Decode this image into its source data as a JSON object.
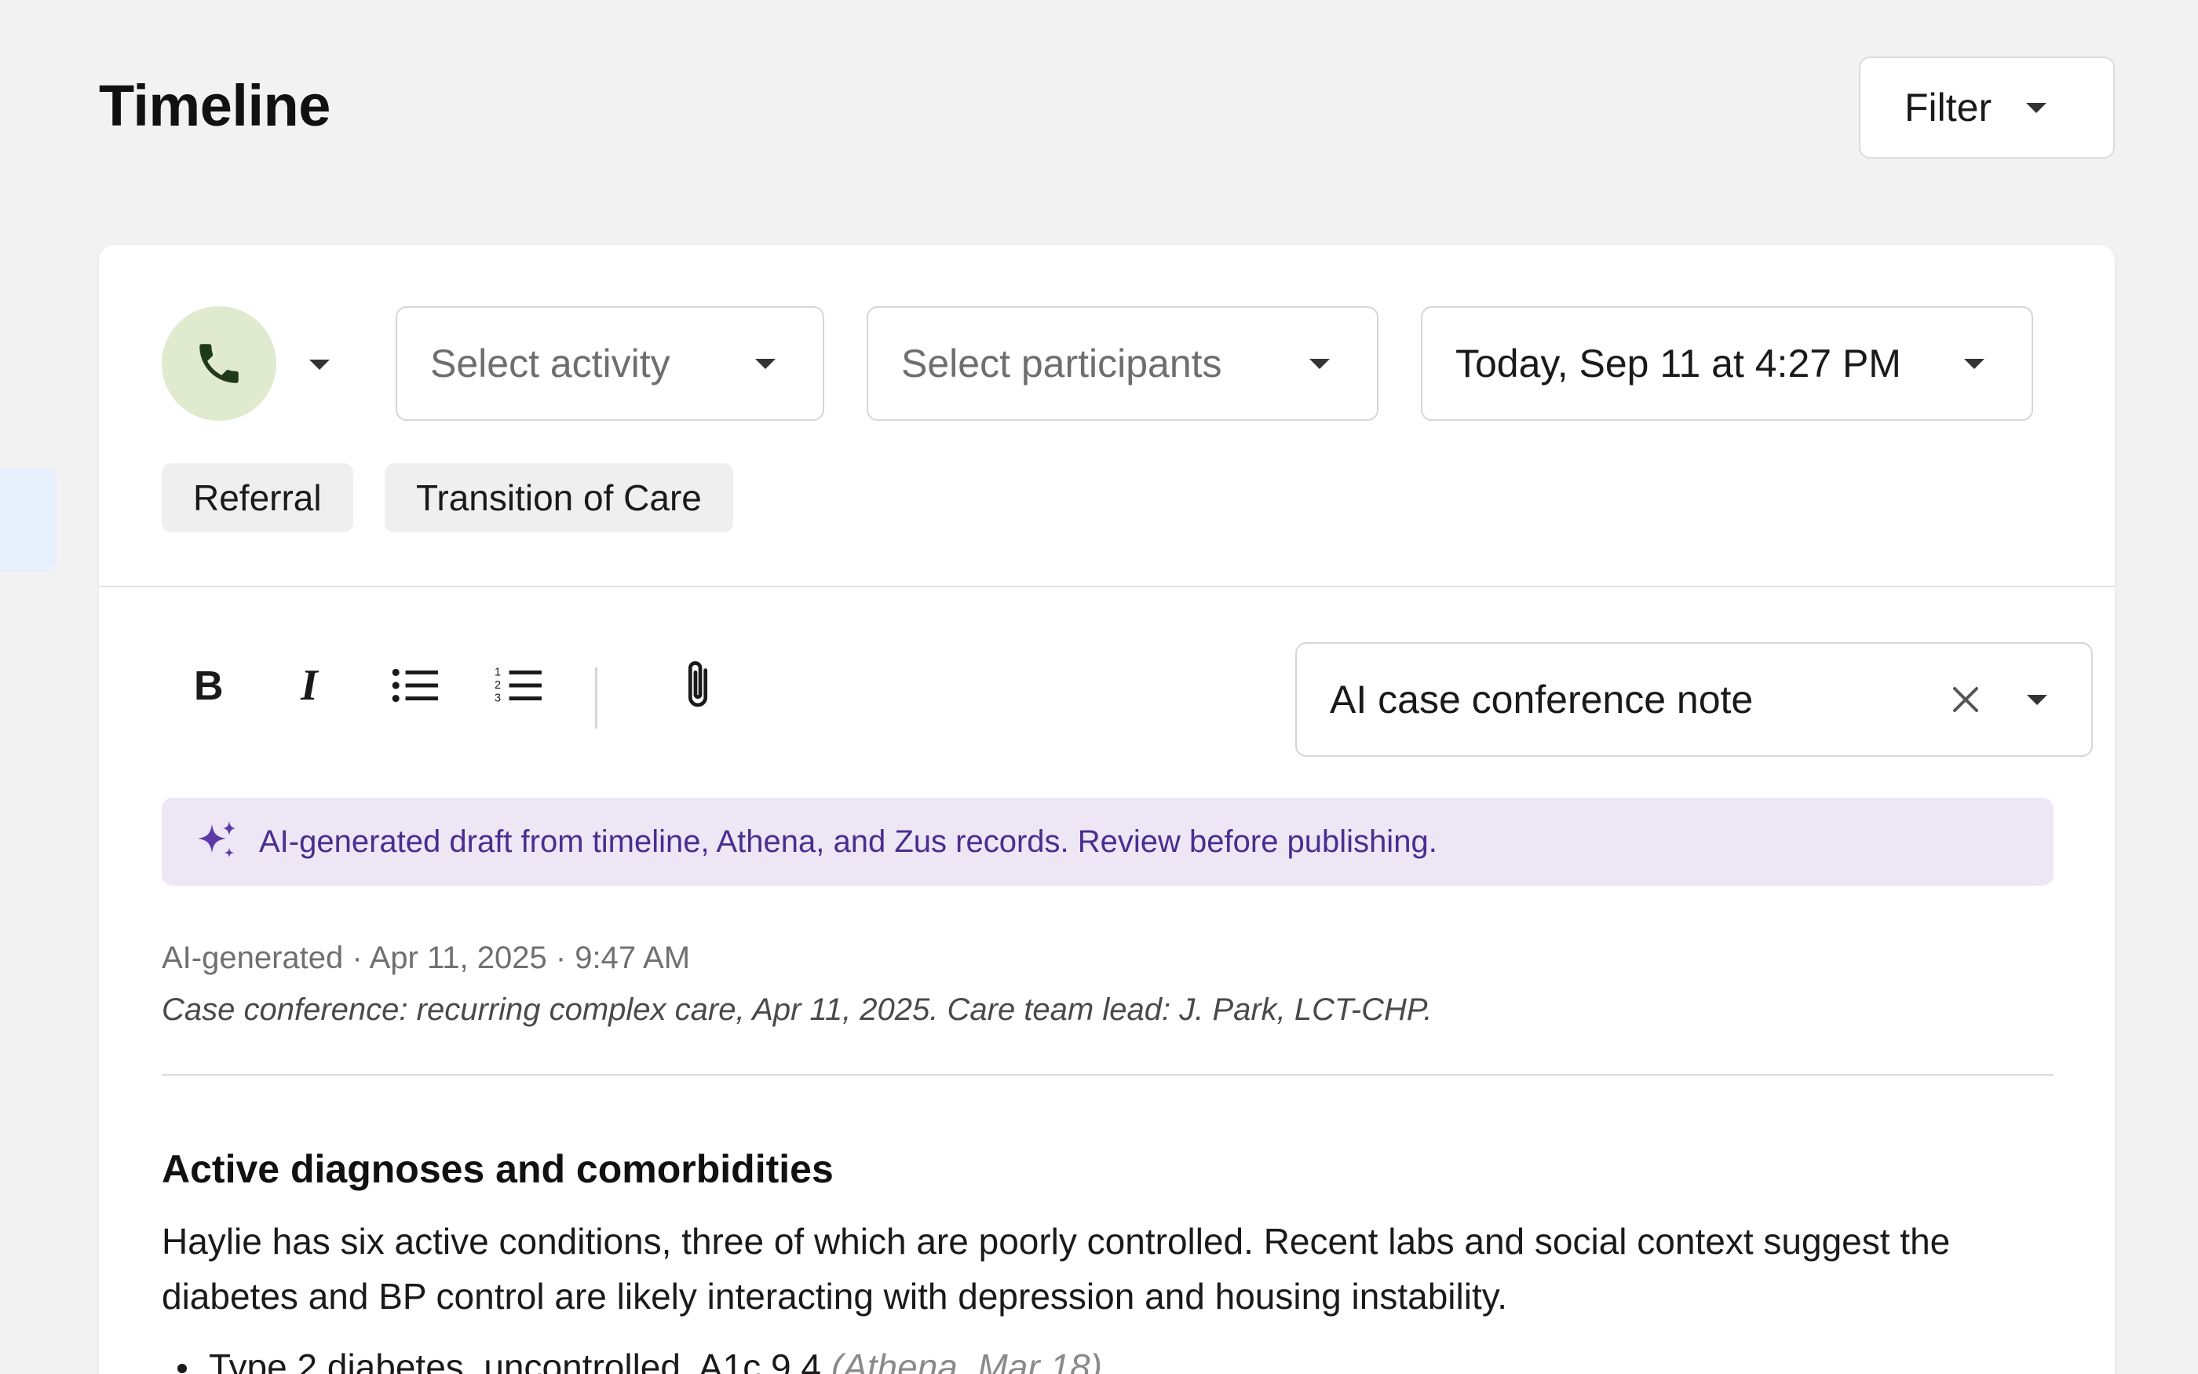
{
  "header": {
    "title": "Timeline",
    "filter_label": "Filter"
  },
  "composer": {
    "activity_type_icon": "phone-icon",
    "activity_placeholder": "Select activity",
    "participants_placeholder": "Select participants",
    "datetime": "Today, Sep 11 at 4:27 PM",
    "tags": [
      "Referral",
      "Transition of Care"
    ]
  },
  "toolbar": {
    "bold_icon": "bold-icon",
    "italic_icon": "italic-icon",
    "bullet_list_icon": "bulleted-list-icon",
    "numbered_list_icon": "numbered-list-icon",
    "attach_icon": "paperclip-icon",
    "template_value": "AI case conference note"
  },
  "ai_banner": {
    "text": "AI-generated draft from timeline, Athena, and Zus records. Review before publishing.",
    "accent_color": "#4a2d8f",
    "background_color": "#ece6f5"
  },
  "note": {
    "meta": "AI-generated · Apr 11, 2025 · 9:47 AM",
    "subtitle": "Case conference: recurring complex care, Apr 11, 2025. Care team lead: J. Park, LCT-CHP.",
    "sections": [
      {
        "heading": "Active diagnoses and comorbidities",
        "body": "Haylie has six active conditions, three of which are poorly controlled. Recent labs and social context suggest the diabetes and BP control are likely interacting with depression and housing instability.",
        "bullets": [
          {
            "text": "Type 2 diabetes, uncontrolled. A1c 9.4",
            "source": "(Athena, Mar 18)"
          }
        ]
      }
    ]
  },
  "colors": {
    "page_bg": "#f2f2f2",
    "phone_circle_bg": "#dfeacf",
    "phone_icon": "#1f3a1a",
    "chip_bg": "#efefef"
  }
}
